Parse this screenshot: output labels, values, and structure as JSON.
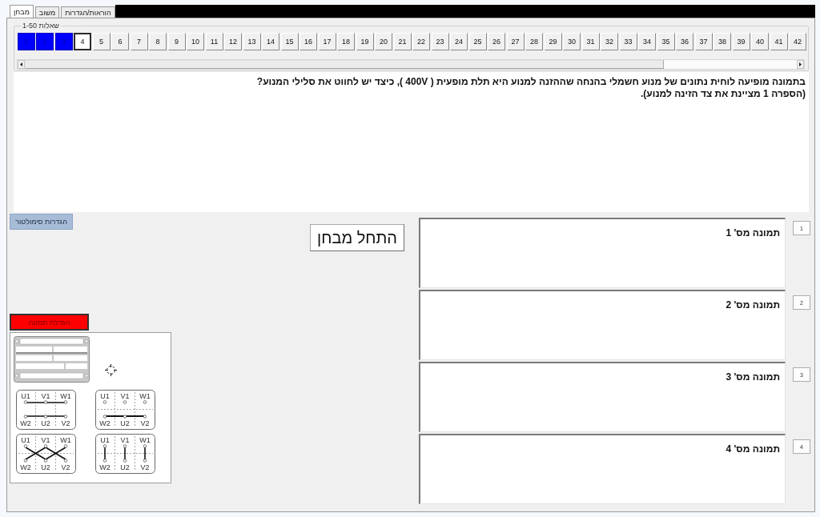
{
  "tabs": [
    {
      "label": "הוראות/הגדרות",
      "selected": false
    },
    {
      "label": "משוב",
      "selected": false
    },
    {
      "label": "מבחן",
      "selected": true
    }
  ],
  "questions_group": {
    "title": "שאלות 1-50",
    "questions": [
      {
        "label": "42",
        "answered": false,
        "selected": false
      },
      {
        "label": "41",
        "answered": false,
        "selected": false
      },
      {
        "label": "40",
        "answered": false,
        "selected": false
      },
      {
        "label": "39",
        "answered": false,
        "selected": false
      },
      {
        "label": "38",
        "answered": false,
        "selected": false
      },
      {
        "label": "37",
        "answered": false,
        "selected": false
      },
      {
        "label": "36",
        "answered": false,
        "selected": false
      },
      {
        "label": "35",
        "answered": false,
        "selected": false
      },
      {
        "label": "34",
        "answered": false,
        "selected": false
      },
      {
        "label": "33",
        "answered": false,
        "selected": false
      },
      {
        "label": "32",
        "answered": false,
        "selected": false
      },
      {
        "label": "31",
        "answered": false,
        "selected": false
      },
      {
        "label": "30",
        "answered": false,
        "selected": false
      },
      {
        "label": "29",
        "answered": false,
        "selected": false
      },
      {
        "label": "28",
        "answered": false,
        "selected": false
      },
      {
        "label": "27",
        "answered": false,
        "selected": false
      },
      {
        "label": "26",
        "answered": false,
        "selected": false
      },
      {
        "label": "25",
        "answered": false,
        "selected": false
      },
      {
        "label": "24",
        "answered": false,
        "selected": false
      },
      {
        "label": "23",
        "answered": false,
        "selected": false
      },
      {
        "label": "22",
        "answered": false,
        "selected": false
      },
      {
        "label": "21",
        "answered": false,
        "selected": false
      },
      {
        "label": "20",
        "answered": false,
        "selected": false
      },
      {
        "label": "19",
        "answered": false,
        "selected": false
      },
      {
        "label": "18",
        "answered": false,
        "selected": false
      },
      {
        "label": "17",
        "answered": false,
        "selected": false
      },
      {
        "label": "16",
        "answered": false,
        "selected": false
      },
      {
        "label": "15",
        "answered": false,
        "selected": false
      },
      {
        "label": "14",
        "answered": false,
        "selected": false
      },
      {
        "label": "13",
        "answered": false,
        "selected": false
      },
      {
        "label": "12",
        "answered": false,
        "selected": false
      },
      {
        "label": "11",
        "answered": false,
        "selected": false
      },
      {
        "label": "10",
        "answered": false,
        "selected": false
      },
      {
        "label": "9",
        "answered": false,
        "selected": false
      },
      {
        "label": "8",
        "answered": false,
        "selected": false
      },
      {
        "label": "7",
        "answered": false,
        "selected": false
      },
      {
        "label": "6",
        "answered": false,
        "selected": false
      },
      {
        "label": "5",
        "answered": false,
        "selected": false
      },
      {
        "label": "4",
        "answered": false,
        "selected": true
      },
      {
        "label": "3",
        "answered": true,
        "selected": false
      },
      {
        "label": "2",
        "answered": true,
        "selected": false
      },
      {
        "label": "1",
        "answered": true,
        "selected": false
      }
    ]
  },
  "question": {
    "text": "בתמונה מופיעה לוחית נתונים של מנוע חשמלי בהנחה שההזנה למנוע היא תלת מופעית ( 400V ), כיצד יש לחווט את סלילי המנוע?\n(הספרה 1 מציינת את צד הזינה למנוע)."
  },
  "simulator_settings_button": "הגדרות סימולטור",
  "start_button": "התחל מבחן",
  "enlarge_image_button": "הגדלת תמונה",
  "image": {
    "diagrams": [
      {
        "kind": "star",
        "top": [
          "W1",
          "V1",
          "U1"
        ],
        "bottom": [
          "V2",
          "U2",
          "W2"
        ]
      },
      {
        "kind": "rows",
        "top": [
          "W1",
          "V1",
          "U1"
        ],
        "bottom": [
          "V2",
          "U2",
          "W2"
        ]
      },
      {
        "kind": "vertical",
        "top": [
          "W1",
          "V1",
          "U1"
        ],
        "bottom": [
          "V2",
          "U2",
          "W2"
        ]
      },
      {
        "kind": "cross",
        "top": [
          "W1",
          "V1",
          "U1"
        ],
        "bottom": [
          "V2",
          "U2",
          "W2"
        ]
      }
    ]
  },
  "answers": [
    {
      "label": "תמונה מס' 1",
      "button": "1",
      "selected": false
    },
    {
      "label": "תמונה מס' 2",
      "button": "2",
      "selected": false
    },
    {
      "label": "תמונה מס' 3",
      "button": "3",
      "selected": false
    },
    {
      "label": "תמונה מס' 4",
      "button": "4",
      "selected": false
    }
  ]
}
